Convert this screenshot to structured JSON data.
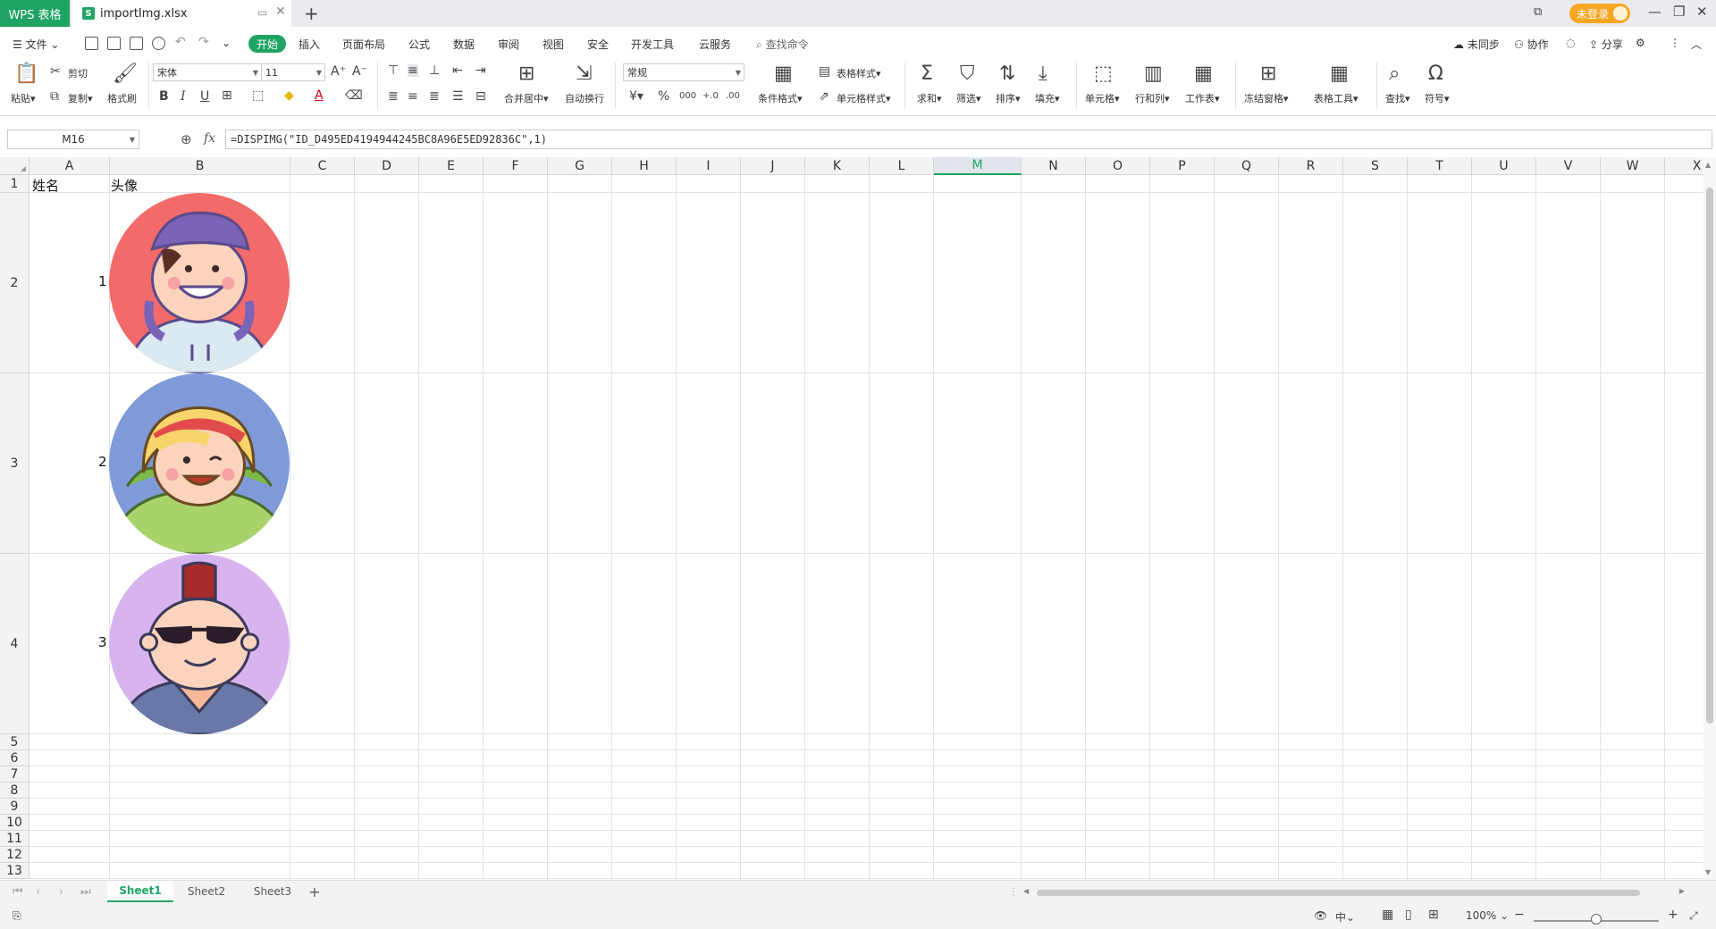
{
  "titlebar": {
    "app_tab": "WPS 表格",
    "file_tab": "importImg.xlsx",
    "file_tab_icon": "S",
    "new_tab": "+",
    "login": "未登录"
  },
  "menubar": {
    "file": "文件",
    "tabs": [
      "开始",
      "插入",
      "页面布局",
      "公式",
      "数据",
      "审阅",
      "视图",
      "安全",
      "开发工具",
      "云服务"
    ],
    "search": "查找命令",
    "sync": "未同步",
    "collab": "协作",
    "share": "分享"
  },
  "ribbon": {
    "paste": "粘贴",
    "cut": "剪切",
    "copy": "复制",
    "format_painter": "格式刷",
    "font_name": "宋体",
    "font_size": "11",
    "merge": "合并居中",
    "wrap": "自动换行",
    "number_format": "常规",
    "cond_format": "条件格式",
    "table_style": "表格样式",
    "cell_style": "单元格样式",
    "sum": "求和",
    "filter": "筛选",
    "sort": "排序",
    "fill": "填充",
    "cell": "单元格",
    "rowcol": "行和列",
    "worksheet": "工作表",
    "freeze": "冻结窗格",
    "table_tools": "表格工具",
    "find": "查找",
    "symbol": "符号",
    "currency": "¥",
    "percent": "%",
    "thousands": "000",
    "inc_dec": "+.0",
    "dec_dec": ".00"
  },
  "formula_bar": {
    "name_box": "M16",
    "fx": "fx",
    "formula": "=DISPIMG(\"ID_D495ED4194944245BC8A96E5ED92836C\",1)"
  },
  "grid": {
    "columns": [
      "A",
      "B",
      "C",
      "D",
      "E",
      "F",
      "G",
      "H",
      "I",
      "J",
      "K",
      "L",
      "M",
      "N",
      "O",
      "P",
      "Q",
      "R",
      "S",
      "T",
      "U",
      "V",
      "W",
      "X"
    ],
    "selected_column": "M",
    "rows": [
      "1",
      "2",
      "3",
      "4",
      "5",
      "6",
      "7",
      "8",
      "9",
      "10",
      "11",
      "12",
      "13"
    ],
    "header_a1": "姓名",
    "header_b1": "头像",
    "records": [
      {
        "id": "1",
        "avatar": "avatar-boy-beanie-icon",
        "bg": "#f26a6a"
      },
      {
        "id": "2",
        "avatar": "avatar-girl-headband-icon",
        "bg": "#7f9ad8"
      },
      {
        "id": "3",
        "avatar": "avatar-punk-sunglasses-icon",
        "bg": "#d8b4ee"
      }
    ]
  },
  "sheets": {
    "tabs": [
      "Sheet1",
      "Sheet2",
      "Sheet3"
    ],
    "active": "Sheet1",
    "add": "+"
  },
  "status": {
    "zoom": "100%",
    "zoom_level": 0.5
  },
  "colors": {
    "accent": "#1fa463",
    "login": "#f5a623"
  }
}
